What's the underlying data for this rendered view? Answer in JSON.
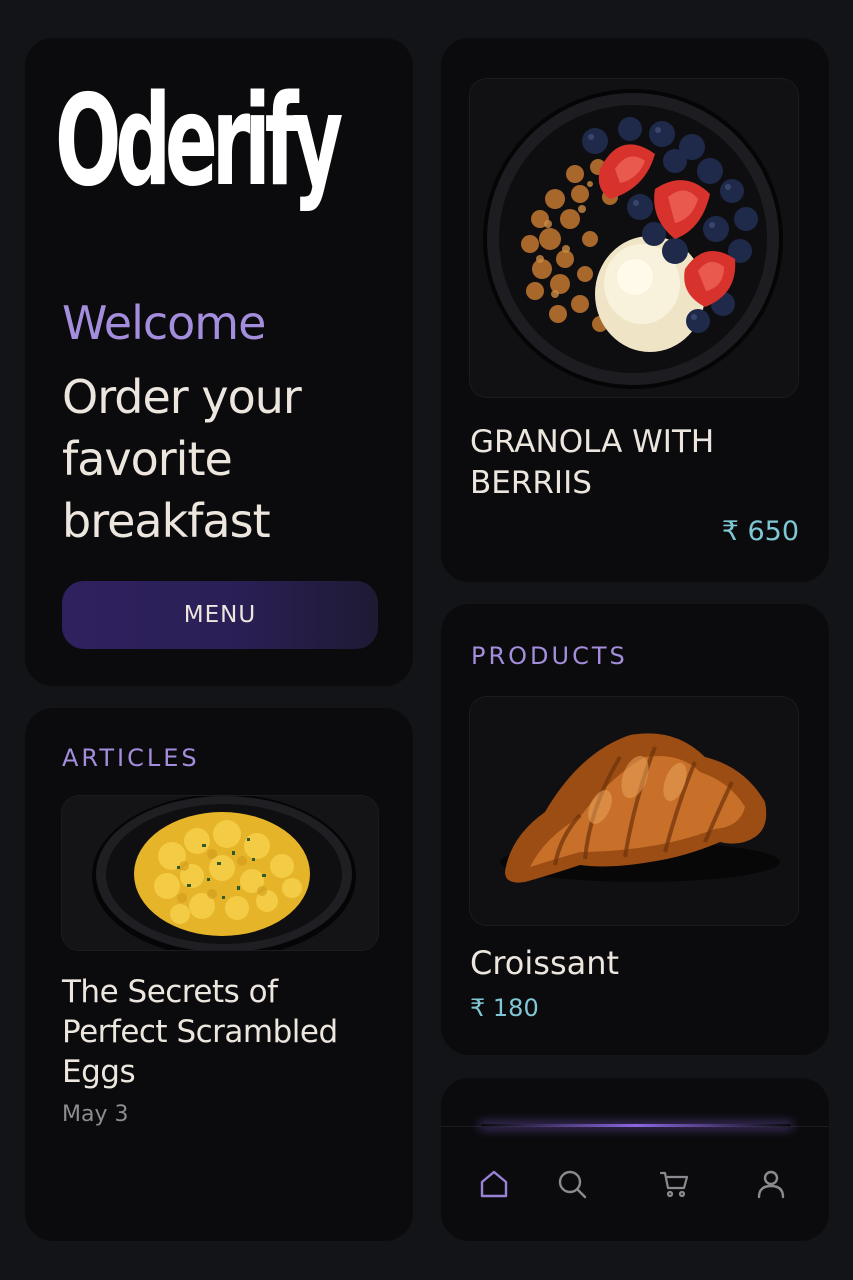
{
  "hero": {
    "logo": "Oderify",
    "welcome": "Welcome",
    "tagline": "Order your favorite breakfast",
    "menu_button": "MENU"
  },
  "featured": {
    "title": "GRANOLA WITH BERRIIS",
    "price": "₹ 650"
  },
  "products": {
    "label": "PRODUCTS",
    "name": "Croissant",
    "price": "₹ 180"
  },
  "articles": {
    "label": "ARTICLES",
    "title": "The Secrets of Perfect Scrambled Eggs",
    "date": "May 3"
  },
  "nav": {
    "items": [
      {
        "icon": "home-icon",
        "active": true
      },
      {
        "icon": "search-icon",
        "active": false
      },
      {
        "icon": "cart-icon",
        "active": false
      },
      {
        "icon": "user-icon",
        "active": false
      }
    ]
  },
  "colors": {
    "background": "#131417",
    "card": "#0b0b0d",
    "accent_purple": "#a48ddc",
    "price_teal": "#7fc7d4",
    "button_purple": "#2f215f"
  }
}
